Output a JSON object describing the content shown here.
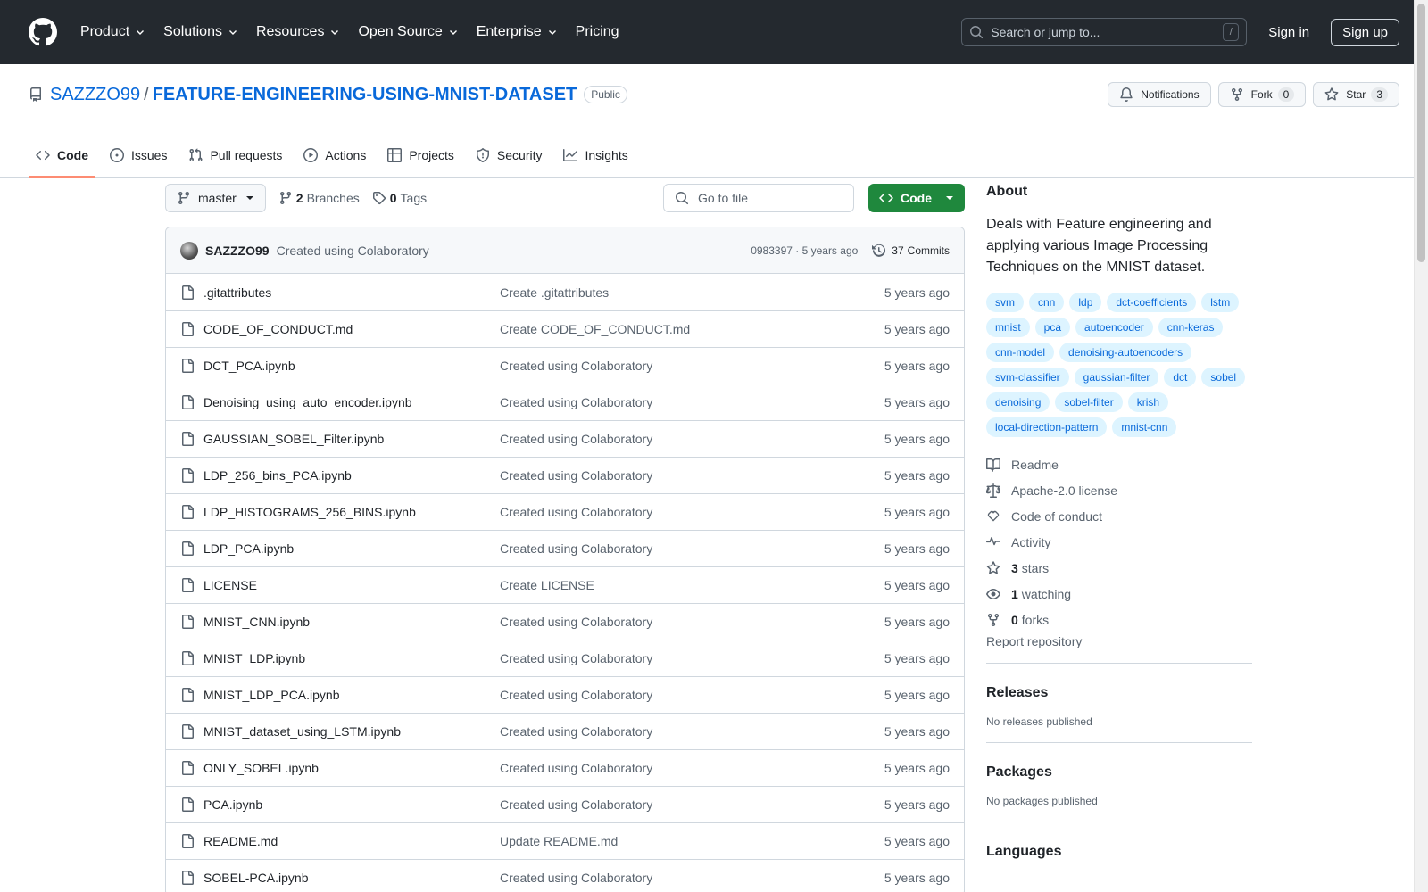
{
  "header": {
    "nav": [
      {
        "label": "Product",
        "has_menu": true
      },
      {
        "label": "Solutions",
        "has_menu": true
      },
      {
        "label": "Resources",
        "has_menu": true
      },
      {
        "label": "Open Source",
        "has_menu": true
      },
      {
        "label": "Enterprise",
        "has_menu": true
      },
      {
        "label": "Pricing",
        "has_menu": false
      }
    ],
    "search_placeholder": "Search or jump to...",
    "search_shortcut": "/",
    "sign_in": "Sign in",
    "sign_up": "Sign up"
  },
  "repo": {
    "owner": "SAZZZO99",
    "separator": "/",
    "name": "FEATURE-ENGINEERING-USING-MNIST-DATASET",
    "visibility": "Public",
    "notifications_label": "Notifications",
    "fork_label": "Fork",
    "fork_count": "0",
    "star_label": "Star",
    "star_count": "3"
  },
  "tabs": [
    {
      "label": "Code",
      "icon": "code-icon",
      "active": true
    },
    {
      "label": "Issues",
      "icon": "issue-icon",
      "active": false
    },
    {
      "label": "Pull requests",
      "icon": "pull-request-icon",
      "active": false
    },
    {
      "label": "Actions",
      "icon": "play-icon",
      "active": false
    },
    {
      "label": "Projects",
      "icon": "table-icon",
      "active": false
    },
    {
      "label": "Security",
      "icon": "shield-icon",
      "active": false
    },
    {
      "label": "Insights",
      "icon": "graph-icon",
      "active": false
    }
  ],
  "toolbar": {
    "branch": "master",
    "branches_count": "2",
    "branches_label": "Branches",
    "tags_count": "0",
    "tags_label": "Tags",
    "goto_placeholder": "Go to file",
    "code_button": "Code"
  },
  "latest_commit": {
    "author": "SAZZZO99",
    "message": "Created using Colaboratory",
    "hash_time": "0983397 · 5 years ago",
    "commits_count": "37",
    "commits_label": "Commits"
  },
  "files": [
    {
      "name": ".gitattributes",
      "message": "Create .gitattributes",
      "date": "5 years ago"
    },
    {
      "name": "CODE_OF_CONDUCT.md",
      "message": "Create CODE_OF_CONDUCT.md",
      "date": "5 years ago"
    },
    {
      "name": "DCT_PCA.ipynb",
      "message": "Created using Colaboratory",
      "date": "5 years ago"
    },
    {
      "name": "Denoising_using_auto_encoder.ipynb",
      "message": "Created using Colaboratory",
      "date": "5 years ago"
    },
    {
      "name": "GAUSSIAN_SOBEL_Filter.ipynb",
      "message": "Created using Colaboratory",
      "date": "5 years ago"
    },
    {
      "name": "LDP_256_bins_PCA.ipynb",
      "message": "Created using Colaboratory",
      "date": "5 years ago"
    },
    {
      "name": "LDP_HISTOGRAMS_256_BINS.ipynb",
      "message": "Created using Colaboratory",
      "date": "5 years ago"
    },
    {
      "name": "LDP_PCA.ipynb",
      "message": "Created using Colaboratory",
      "date": "5 years ago"
    },
    {
      "name": "LICENSE",
      "message": "Create LICENSE",
      "date": "5 years ago"
    },
    {
      "name": "MNIST_CNN.ipynb",
      "message": "Created using Colaboratory",
      "date": "5 years ago"
    },
    {
      "name": "MNIST_LDP.ipynb",
      "message": "Created using Colaboratory",
      "date": "5 years ago"
    },
    {
      "name": "MNIST_LDP_PCA.ipynb",
      "message": "Created using Colaboratory",
      "date": "5 years ago"
    },
    {
      "name": "MNIST_dataset_using_LSTM.ipynb",
      "message": "Created using Colaboratory",
      "date": "5 years ago"
    },
    {
      "name": "ONLY_SOBEL.ipynb",
      "message": "Created using Colaboratory",
      "date": "5 years ago"
    },
    {
      "name": "PCA.ipynb",
      "message": "Created using Colaboratory",
      "date": "5 years ago"
    },
    {
      "name": "README.md",
      "message": "Update README.md",
      "date": "5 years ago"
    },
    {
      "name": "SOBEL-PCA.ipynb",
      "message": "Created using Colaboratory",
      "date": "5 years ago"
    }
  ],
  "about": {
    "title": "About",
    "description": "Deals with Feature engineering and applying various Image Processing Techniques on the MNIST dataset.",
    "topics": [
      "svm",
      "cnn",
      "ldp",
      "dct-coefficients",
      "lstm",
      "mnist",
      "pca",
      "autoencoder",
      "cnn-keras",
      "cnn-model",
      "denoising-autoencoders",
      "svm-classifier",
      "gaussian-filter",
      "dct",
      "sobel",
      "denoising",
      "sobel-filter",
      "krish",
      "local-direction-pattern",
      "mnist-cnn"
    ],
    "links": [
      {
        "icon": "book-icon",
        "count": "",
        "label": "Readme"
      },
      {
        "icon": "law-icon",
        "count": "",
        "label": "Apache-2.0 license"
      },
      {
        "icon": "code-of-conduct-icon",
        "count": "",
        "label": "Code of conduct"
      },
      {
        "icon": "pulse-icon",
        "count": "",
        "label": "Activity"
      },
      {
        "icon": "star-icon",
        "count": "3",
        "label": "stars"
      },
      {
        "icon": "eye-icon",
        "count": "1",
        "label": "watching"
      },
      {
        "icon": "fork-icon",
        "count": "0",
        "label": "forks"
      }
    ],
    "report": "Report repository"
  },
  "releases": {
    "title": "Releases",
    "empty": "No releases published"
  },
  "packages": {
    "title": "Packages",
    "empty": "No packages published"
  },
  "languages": {
    "title": "Languages"
  },
  "colors": {
    "header_bg": "#24292f",
    "link": "#0969da",
    "code_button": "#1f883d",
    "active_tab_underline": "#fd8c73",
    "topic_bg": "#ddf4ff"
  }
}
